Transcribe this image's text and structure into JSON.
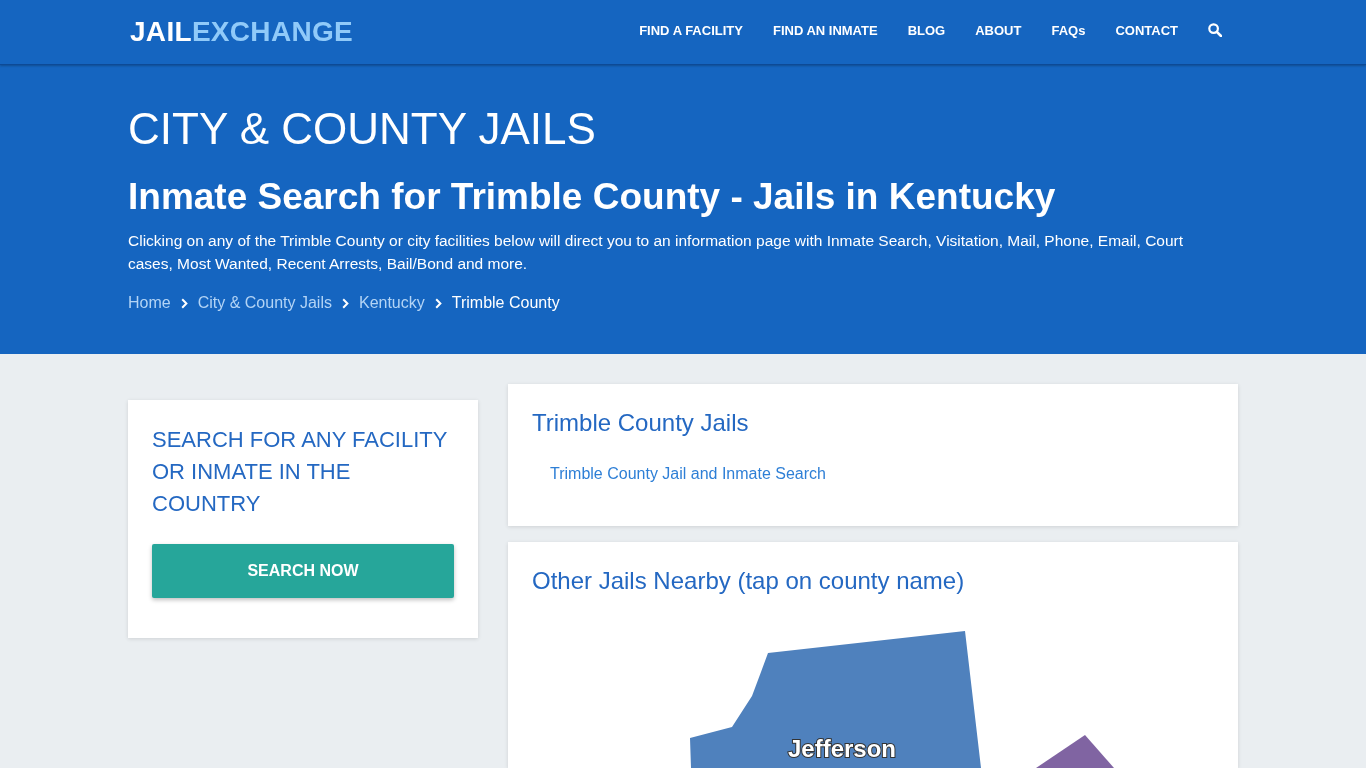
{
  "header": {
    "logo": {
      "first": "JAIL",
      "second": "EXCHANGE"
    },
    "nav": [
      "FIND A FACILITY",
      "FIND AN INMATE",
      "BLOG",
      "ABOUT",
      "FAQs",
      "CONTACT"
    ]
  },
  "hero": {
    "title": "CITY & COUNTY JAILS",
    "subtitle": "Inmate Search for Trimble County - Jails in Kentucky",
    "description": "Clicking on any of the Trimble County or city facilities below will direct you to an information page with Inmate Search, Visitation, Mail, Phone, Email, Court cases, Most Wanted, Recent Arrests, Bail/Bond and more.",
    "breadcrumb": [
      {
        "label": "Home",
        "selected": false
      },
      {
        "label": "City & County Jails",
        "selected": false
      },
      {
        "label": "Kentucky",
        "selected": false
      },
      {
        "label": "Trimble County",
        "selected": true
      }
    ]
  },
  "search_card": {
    "title": "SEARCH FOR ANY FACILITY OR INMATE IN THE COUNTRY",
    "button": "SEARCH NOW"
  },
  "county_jails": {
    "title": "Trimble County Jails",
    "links": [
      "Trimble County Jail and Inmate Search"
    ]
  },
  "nearby": {
    "title": "Other Jails Nearby (tap on county name)",
    "counties": [
      {
        "name": "Jefferson",
        "color": "#4f81bd"
      },
      {
        "color": "#8064a2"
      }
    ]
  }
}
